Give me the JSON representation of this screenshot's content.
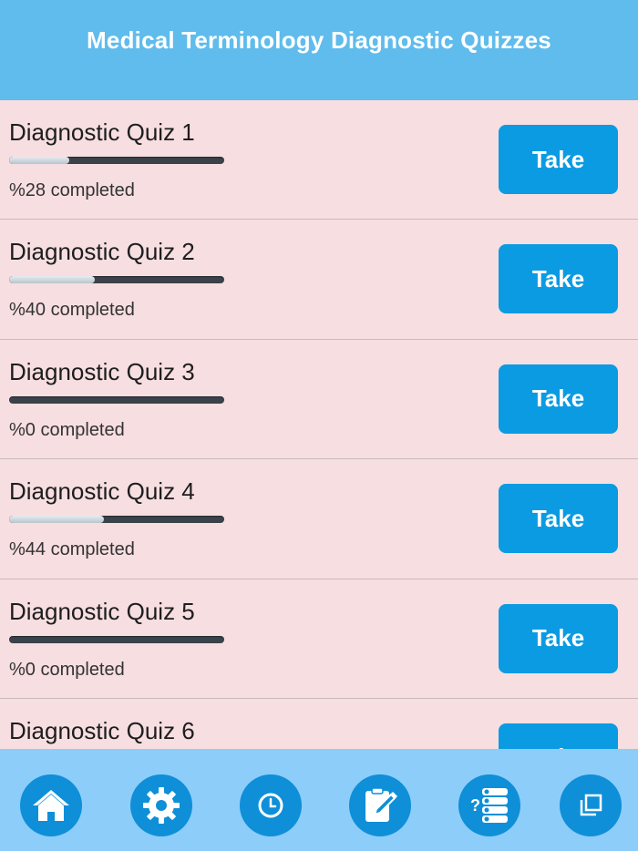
{
  "header": {
    "title": "Medical Terminology Diagnostic Quizzes"
  },
  "quizzes": [
    {
      "title": "Diagnostic Quiz 1",
      "progress": 0.28,
      "status": "%28 completed",
      "button": "Take"
    },
    {
      "title": "Diagnostic Quiz 2",
      "progress": 0.4,
      "status": "%40 completed",
      "button": "Take"
    },
    {
      "title": "Diagnostic Quiz 3",
      "progress": 0.0,
      "status": "%0 completed",
      "button": "Take"
    },
    {
      "title": "Diagnostic Quiz 4",
      "progress": 0.44,
      "status": "%44 completed",
      "button": "Take"
    },
    {
      "title": "Diagnostic Quiz 5",
      "progress": 0.0,
      "status": "%0 completed",
      "button": "Take"
    },
    {
      "title": "Diagnostic Quiz 6",
      "button": "Take"
    }
  ],
  "tabbar": {
    "items": [
      {
        "icon": "home-icon"
      },
      {
        "icon": "gear-icon"
      },
      {
        "icon": "clock-icon"
      },
      {
        "icon": "notepad-edit-icon"
      },
      {
        "icon": "quiz-list-icon"
      },
      {
        "icon": "copy-icon"
      }
    ]
  },
  "colors": {
    "header": "#5fbcec",
    "list_background": "#f7dee1",
    "button": "#0b9be2",
    "tabbar": "#8dcdfa",
    "tab_circle": "#0e8fd8"
  }
}
